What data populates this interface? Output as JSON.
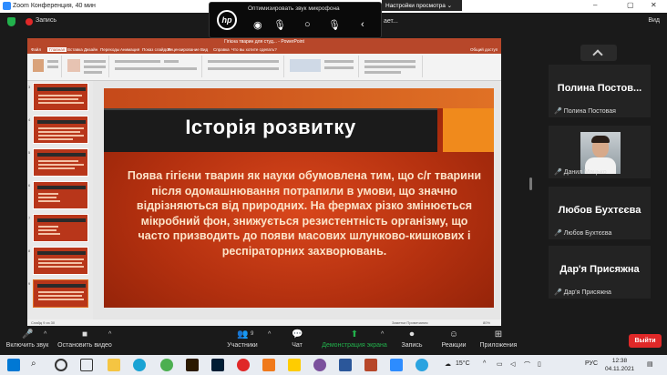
{
  "window": {
    "title": "Zoom Конференция, 40 мин",
    "minimize": "–",
    "maximize": "▢",
    "close": "✕"
  },
  "top": {
    "recording_label": "Запись",
    "view_label": "Вид",
    "view_settings": "Настройки просмотра ⌄",
    "truncated_text": "ает..."
  },
  "hp_panel": {
    "logo": "hp",
    "title": "Оптимизировать звук микрофона"
  },
  "ppt": {
    "window_title": "Гігієна тварин для студ... - PowerPoint",
    "tabs": [
      "Файл",
      "Главная",
      "Вставка",
      "Дизайн",
      "Переходы",
      "Анимация",
      "Показ слайдов",
      "Рецензирование",
      "Вид",
      "Справка",
      "Что вы хотите сделать?"
    ],
    "share_label": "Общий доступ",
    "status_left": "Слайд 9 из 30",
    "status_right": "Заметки   Примечания",
    "zoom": "80%"
  },
  "thumbnails": {
    "numbers": [
      "3",
      "4",
      "5",
      "6",
      "7",
      "8",
      "9"
    ],
    "titles": [
      "Історія тварин",
      "Завдання гігієни",
      "Гігієна",
      "Зв'язок з іншими науками",
      "Зв'язок з іншими науками",
      "Історія розвитку",
      "Історія розвитку"
    ]
  },
  "slide": {
    "title": "Історія розвитку",
    "body": "Поява гігієни тварин як науки обумовлена тим, що с/г тварини після одомашнювання потрапили в умови, що значно відрізняються від природних. На фермах різко змінюється  мікробний фон, знижується резистентність організму, що часто призводить до появи масових шлунково-кишкових і респіраторних захворювань."
  },
  "participants": [
    {
      "display": "Полина  Постов...",
      "label": "Полина Постовая"
    },
    {
      "display": "",
      "label": "Данил Мацько"
    },
    {
      "display": "Любов Бухтєєва",
      "label": "Любов Бухтєєва"
    },
    {
      "display": "Дар'я Присяжна",
      "label": "Дар'я Присяжна"
    }
  ],
  "toolbar": {
    "mute": "Включить звук",
    "video": "Остановить видео",
    "participants": "Участники",
    "participants_count": "9",
    "chat": "Чат",
    "share": "Демонстрация экрана",
    "record": "Запись",
    "reactions": "Реакции",
    "apps": "Приложения",
    "end": "Выйти"
  },
  "taskbar": {
    "temperature": "15°C",
    "lang": "РУС",
    "time": "12:38",
    "date": "04.11.2021",
    "icons": [
      "windows-icon",
      "search-icon",
      "cortana-icon",
      "task-view-icon",
      "file-explorer-icon",
      "edge-icon",
      "chrome-icon",
      "illustrator-icon",
      "photoshop-icon",
      "yandex-icon",
      "store-icon",
      "yandex-browser-icon",
      "viber-icon",
      "word-icon",
      "powerpoint-icon",
      "zoom-icon",
      "telegram-icon"
    ]
  },
  "colors": {
    "accent_red": "#e02828",
    "zoom_blue": "#2d8cff",
    "share_green": "#22b14c",
    "ppt_orange": "#b7472a"
  }
}
